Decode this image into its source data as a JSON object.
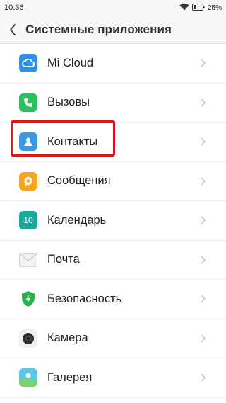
{
  "status": {
    "time": "10:36",
    "battery": "25%"
  },
  "header": {
    "title": "Системные приложения"
  },
  "list": {
    "items": [
      {
        "label": "Mi Cloud",
        "icon": "cloud-icon",
        "color": "#2f8fe4"
      },
      {
        "label": "Вызовы",
        "icon": "phone-icon",
        "color": "#2dbf5e"
      },
      {
        "label": "Контакты",
        "icon": "contacts-icon",
        "color": "#3a97e0"
      },
      {
        "label": "Сообщения",
        "icon": "messages-icon",
        "color": "#f6a623"
      },
      {
        "label": "Календарь",
        "icon": "calendar-icon",
        "color": "#1aa89a",
        "icon_text": "10"
      },
      {
        "label": "Почта",
        "icon": "mail-icon",
        "color": "#e9e9e9"
      },
      {
        "label": "Безопасность",
        "icon": "security-icon",
        "color": "#2db14c"
      },
      {
        "label": "Камера",
        "icon": "camera-icon",
        "color": "#f0f0f0"
      },
      {
        "label": "Галерея",
        "icon": "gallery-icon",
        "color": "#5cc6e6"
      }
    ]
  },
  "highlight": {
    "color": "#e0161c"
  }
}
